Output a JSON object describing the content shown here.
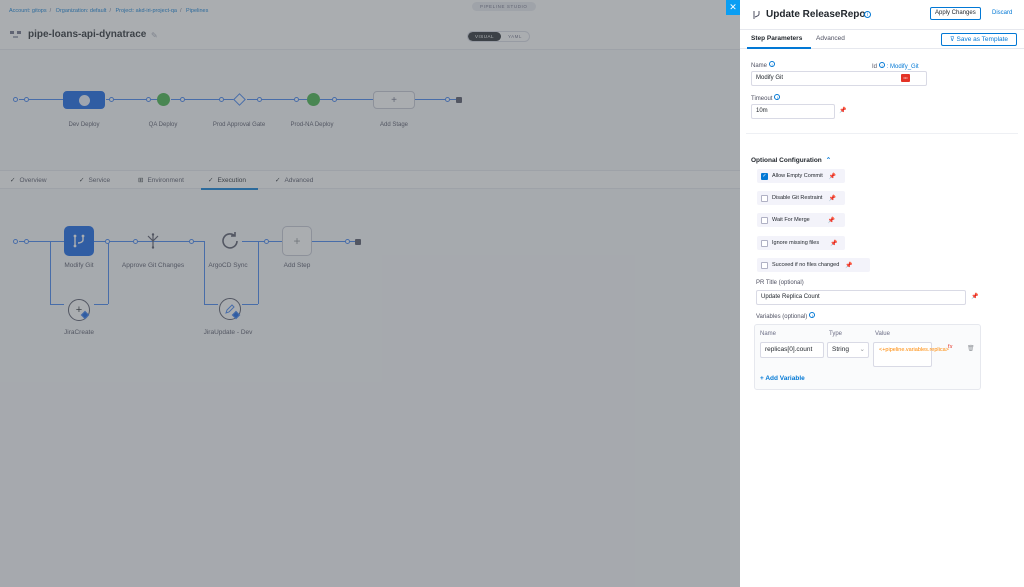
{
  "breadcrumb": [
    "Account: gitops",
    "Organization: default",
    "Project: akd-iri-project-qa",
    "Pipelines"
  ],
  "studio_badge": "PIPELINE STUDIO",
  "pipeline_name": "pipe-loans-api-dynatrace",
  "view_toggle": {
    "visual": "VISUAL",
    "yaml": "YAML"
  },
  "stages": [
    {
      "label": "Dev Deploy"
    },
    {
      "label": "QA Deploy"
    },
    {
      "label": "Prod Approval Gate"
    },
    {
      "label": "Prod-NA Deploy"
    },
    {
      "label": "Add Stage"
    }
  ],
  "stage_tabs": [
    "Overview",
    "Service",
    "Environment",
    "Execution",
    "Advanced"
  ],
  "steps": {
    "modify_git": "Modify Git",
    "approve_git": "Approve Git Changes",
    "argocd_sync": "ArgoCD Sync",
    "add_step": "Add Step",
    "jira_create": "JiraCreate",
    "jira_update": "JiraUpdate - Dev"
  },
  "panel": {
    "title": "Update ReleaseRepo",
    "apply_label": "Apply Changes",
    "discard_label": "Discard",
    "tabs": [
      "Step Parameters",
      "Advanced"
    ],
    "save_template_label": "Save as Template",
    "name_label": "Name",
    "id_label": "Id",
    "id_value": ": Modify_Git",
    "name_value": "Modify Git",
    "timeout_label": "Timeout",
    "timeout_value": "10m",
    "optional_config_label": "Optional Configuration",
    "options": [
      {
        "label": "Allow Empty Commit",
        "checked": true
      },
      {
        "label": "Disable Git Restraint",
        "checked": false
      },
      {
        "label": "Wait For Merge",
        "checked": false
      },
      {
        "label": "Ignore missing files",
        "checked": false
      },
      {
        "label": "Succeed if no files changed",
        "checked": false
      }
    ],
    "pr_title_label": "PR Title (optional)",
    "pr_title_value": "Update Replica Count",
    "variables_label": "Variables (optional)",
    "variables_headers": {
      "name": "Name",
      "type": "Type",
      "value": "Value"
    },
    "variable": {
      "name": "replicas[0].count",
      "type": "String",
      "value": "<+pipeline.variables.replica>"
    },
    "add_variable_label": "+ Add Variable"
  },
  "colors": {
    "accent": "#0278d5",
    "selected_node": "#0a5ee5",
    "expression": "#ff8800"
  }
}
